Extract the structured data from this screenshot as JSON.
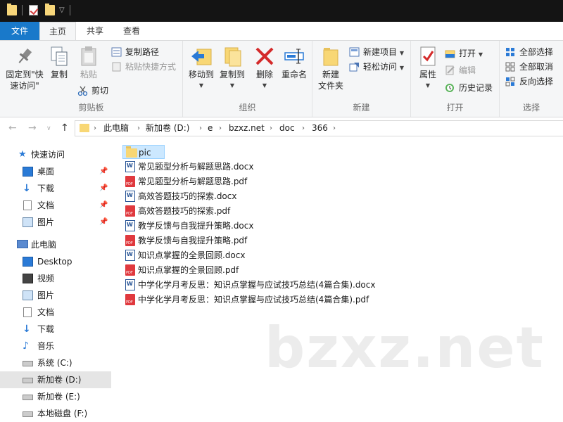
{
  "ribbon_tabs": {
    "file": "文件",
    "home": "主页",
    "share": "共享",
    "view": "查看"
  },
  "clipboard": {
    "pin_label_1": "固定到\"快",
    "pin_label_2": "速访问\"",
    "copy": "复制",
    "paste": "粘贴",
    "copy_path": "复制路径",
    "paste_shortcut": "粘贴快捷方式",
    "cut": "剪切",
    "group": "剪贴板"
  },
  "organize": {
    "move_to": "移动到",
    "copy_to": "复制到",
    "delete": "删除",
    "rename": "重命名",
    "group": "组织"
  },
  "new": {
    "new_folder_1": "新建",
    "new_folder_2": "文件夹",
    "new_item": "新建项目",
    "easy_access": "轻松访问",
    "group": "新建"
  },
  "open": {
    "properties": "属性",
    "open": "打开",
    "edit": "编辑",
    "history": "历史记录",
    "group": "打开"
  },
  "select": {
    "select_all": "全部选择",
    "select_none": "全部取消",
    "invert": "反向选择",
    "group": "选择"
  },
  "breadcrumb": [
    "此电脑",
    "新加卷 (D:)",
    "e",
    "bzxz.net",
    "doc",
    "366"
  ],
  "sidebar": {
    "quick_access": "快速访问",
    "desktop": "桌面",
    "downloads": "下载",
    "documents": "文档",
    "pictures": "图片",
    "this_pc": "此电脑",
    "pc_desktop": "Desktop",
    "videos": "视频",
    "pc_pictures": "图片",
    "pc_documents": "文档",
    "pc_downloads": "下载",
    "music": "音乐",
    "drive_c": "系统 (C:)",
    "drive_d": "新加卷 (D:)",
    "drive_e": "新加卷 (E:)",
    "drive_f": "本地磁盘 (F:)"
  },
  "files": [
    {
      "name": "pic",
      "type": "folder"
    },
    {
      "name": "常见题型分析与解题思路.docx",
      "type": "docx"
    },
    {
      "name": "常见题型分析与解题思路.pdf",
      "type": "pdf"
    },
    {
      "name": "高效答题技巧的探索.docx",
      "type": "docx"
    },
    {
      "name": "高效答题技巧的探索.pdf",
      "type": "pdf"
    },
    {
      "name": "教学反馈与自我提升策略.docx",
      "type": "docx"
    },
    {
      "name": "教学反馈与自我提升策略.pdf",
      "type": "pdf"
    },
    {
      "name": "知识点掌握的全景回顾.docx",
      "type": "docx"
    },
    {
      "name": "知识点掌握的全景回顾.pdf",
      "type": "pdf"
    },
    {
      "name": "中学化学月考反思：知识点掌握与应试技巧总结(4篇合集).docx",
      "type": "docx"
    },
    {
      "name": "中学化学月考反思：知识点掌握与应试技巧总结(4篇合集).pdf",
      "type": "pdf"
    }
  ],
  "watermark": "bzxz.net"
}
